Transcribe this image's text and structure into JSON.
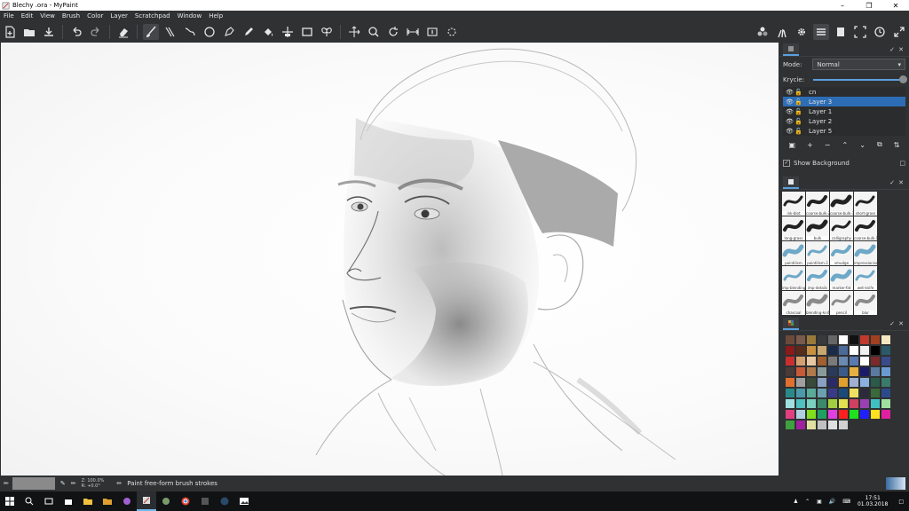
{
  "window": {
    "title": "Blechy .ora - MyPaint"
  },
  "menu": [
    "File",
    "Edit",
    "View",
    "Brush",
    "Color",
    "Layer",
    "Scratchpad",
    "Window",
    "Help"
  ],
  "layers_panel": {
    "mode_label": "Mode:",
    "mode_value": "Normal",
    "opacity_label": "Krycie:",
    "layers": [
      {
        "name": "cn",
        "selected": false
      },
      {
        "name": "Layer 3",
        "selected": true
      },
      {
        "name": "Layer 1",
        "selected": false
      },
      {
        "name": "Layer 2",
        "selected": false
      },
      {
        "name": "Layer 5",
        "selected": false
      }
    ],
    "show_background_label": "Show Background"
  },
  "brushes": [
    "ink-blot",
    "coarse-bulk-2",
    "coarse-bulk-3",
    "short-grass",
    "long-grass",
    "bulk",
    "calligraphy",
    "coarse-bulk-1",
    "pointilism",
    "pointilism-2",
    "smudge",
    "impressionism",
    "imp-blending",
    "imp-details",
    "marker-fat",
    "wet-knife",
    "charcoal",
    "blending-knife",
    "pencil",
    "blur"
  ],
  "palette": [
    "#6b4a3a",
    "#7a5a4a",
    "#9a7a3a",
    "#3a3a3a",
    "#666666",
    "#ffffff",
    "#111111",
    "#c0392b",
    "#a04020",
    "#f4e8c0",
    "#8b1a1a",
    "#5a2a1a",
    "#c89040",
    "#c8a870",
    "#1a2a4a",
    "#4a6a9a",
    "#ffffff",
    "#f0f0f0",
    "#000000",
    "#2a5a6a",
    "#c83030",
    "#d4a070",
    "#e8c8a0",
    "#a06030",
    "#7a7a7a",
    "#6a8ab0",
    "#5a7ab0",
    "#ffffff",
    "#7a2a2a",
    "#3a4a8a",
    "#4a3a3a",
    "#c85a3a",
    "#b07a4a",
    "#8a9a9a",
    "#2a3a5a",
    "#3a5a8a",
    "#e8b040",
    "#1a1a6a",
    "#5a7aa0",
    "#6a9ad0",
    "#e07030",
    "#a0a0a0",
    "#3a4a3a",
    "#8aa0c0",
    "#2a2a6a",
    "#e0a030",
    "#a0b0d0",
    "#8ab0e0",
    "#2a5a4a",
    "#3a7a6a",
    "#2a8a8a",
    "#4a9aaa",
    "#5aaa9a",
    "#6aa0b0",
    "#3a3a8a",
    "#1a4a7a",
    "#f0e060",
    "#2a2a3a",
    "#3a6a3a",
    "#2a4a8a",
    "#a0e0e0",
    "#50c0c0",
    "#7ad0c0",
    "#3a8a6a",
    "#a0d040",
    "#e0e050",
    "#d04060",
    "#9a40b0",
    "#40c0c0",
    "#a0e0a0",
    "#e04080",
    "#b0d0e0",
    "#80e020",
    "#20a060",
    "#e040e0",
    "#ff2020",
    "#20e020",
    "#2020ff",
    "#ffe020",
    "#e020a0",
    "#40a040",
    "#a020a0",
    "#e0e0a0",
    "#c0c0c0",
    "#e0e0e0",
    "#d0d0d0"
  ],
  "status": {
    "zoom": "Z: 100.0%",
    "rotation": "R: +0.0°",
    "message": "Paint free-form brush strokes"
  },
  "taskbar": {
    "time": "17:51",
    "date": "01.03.2018"
  }
}
